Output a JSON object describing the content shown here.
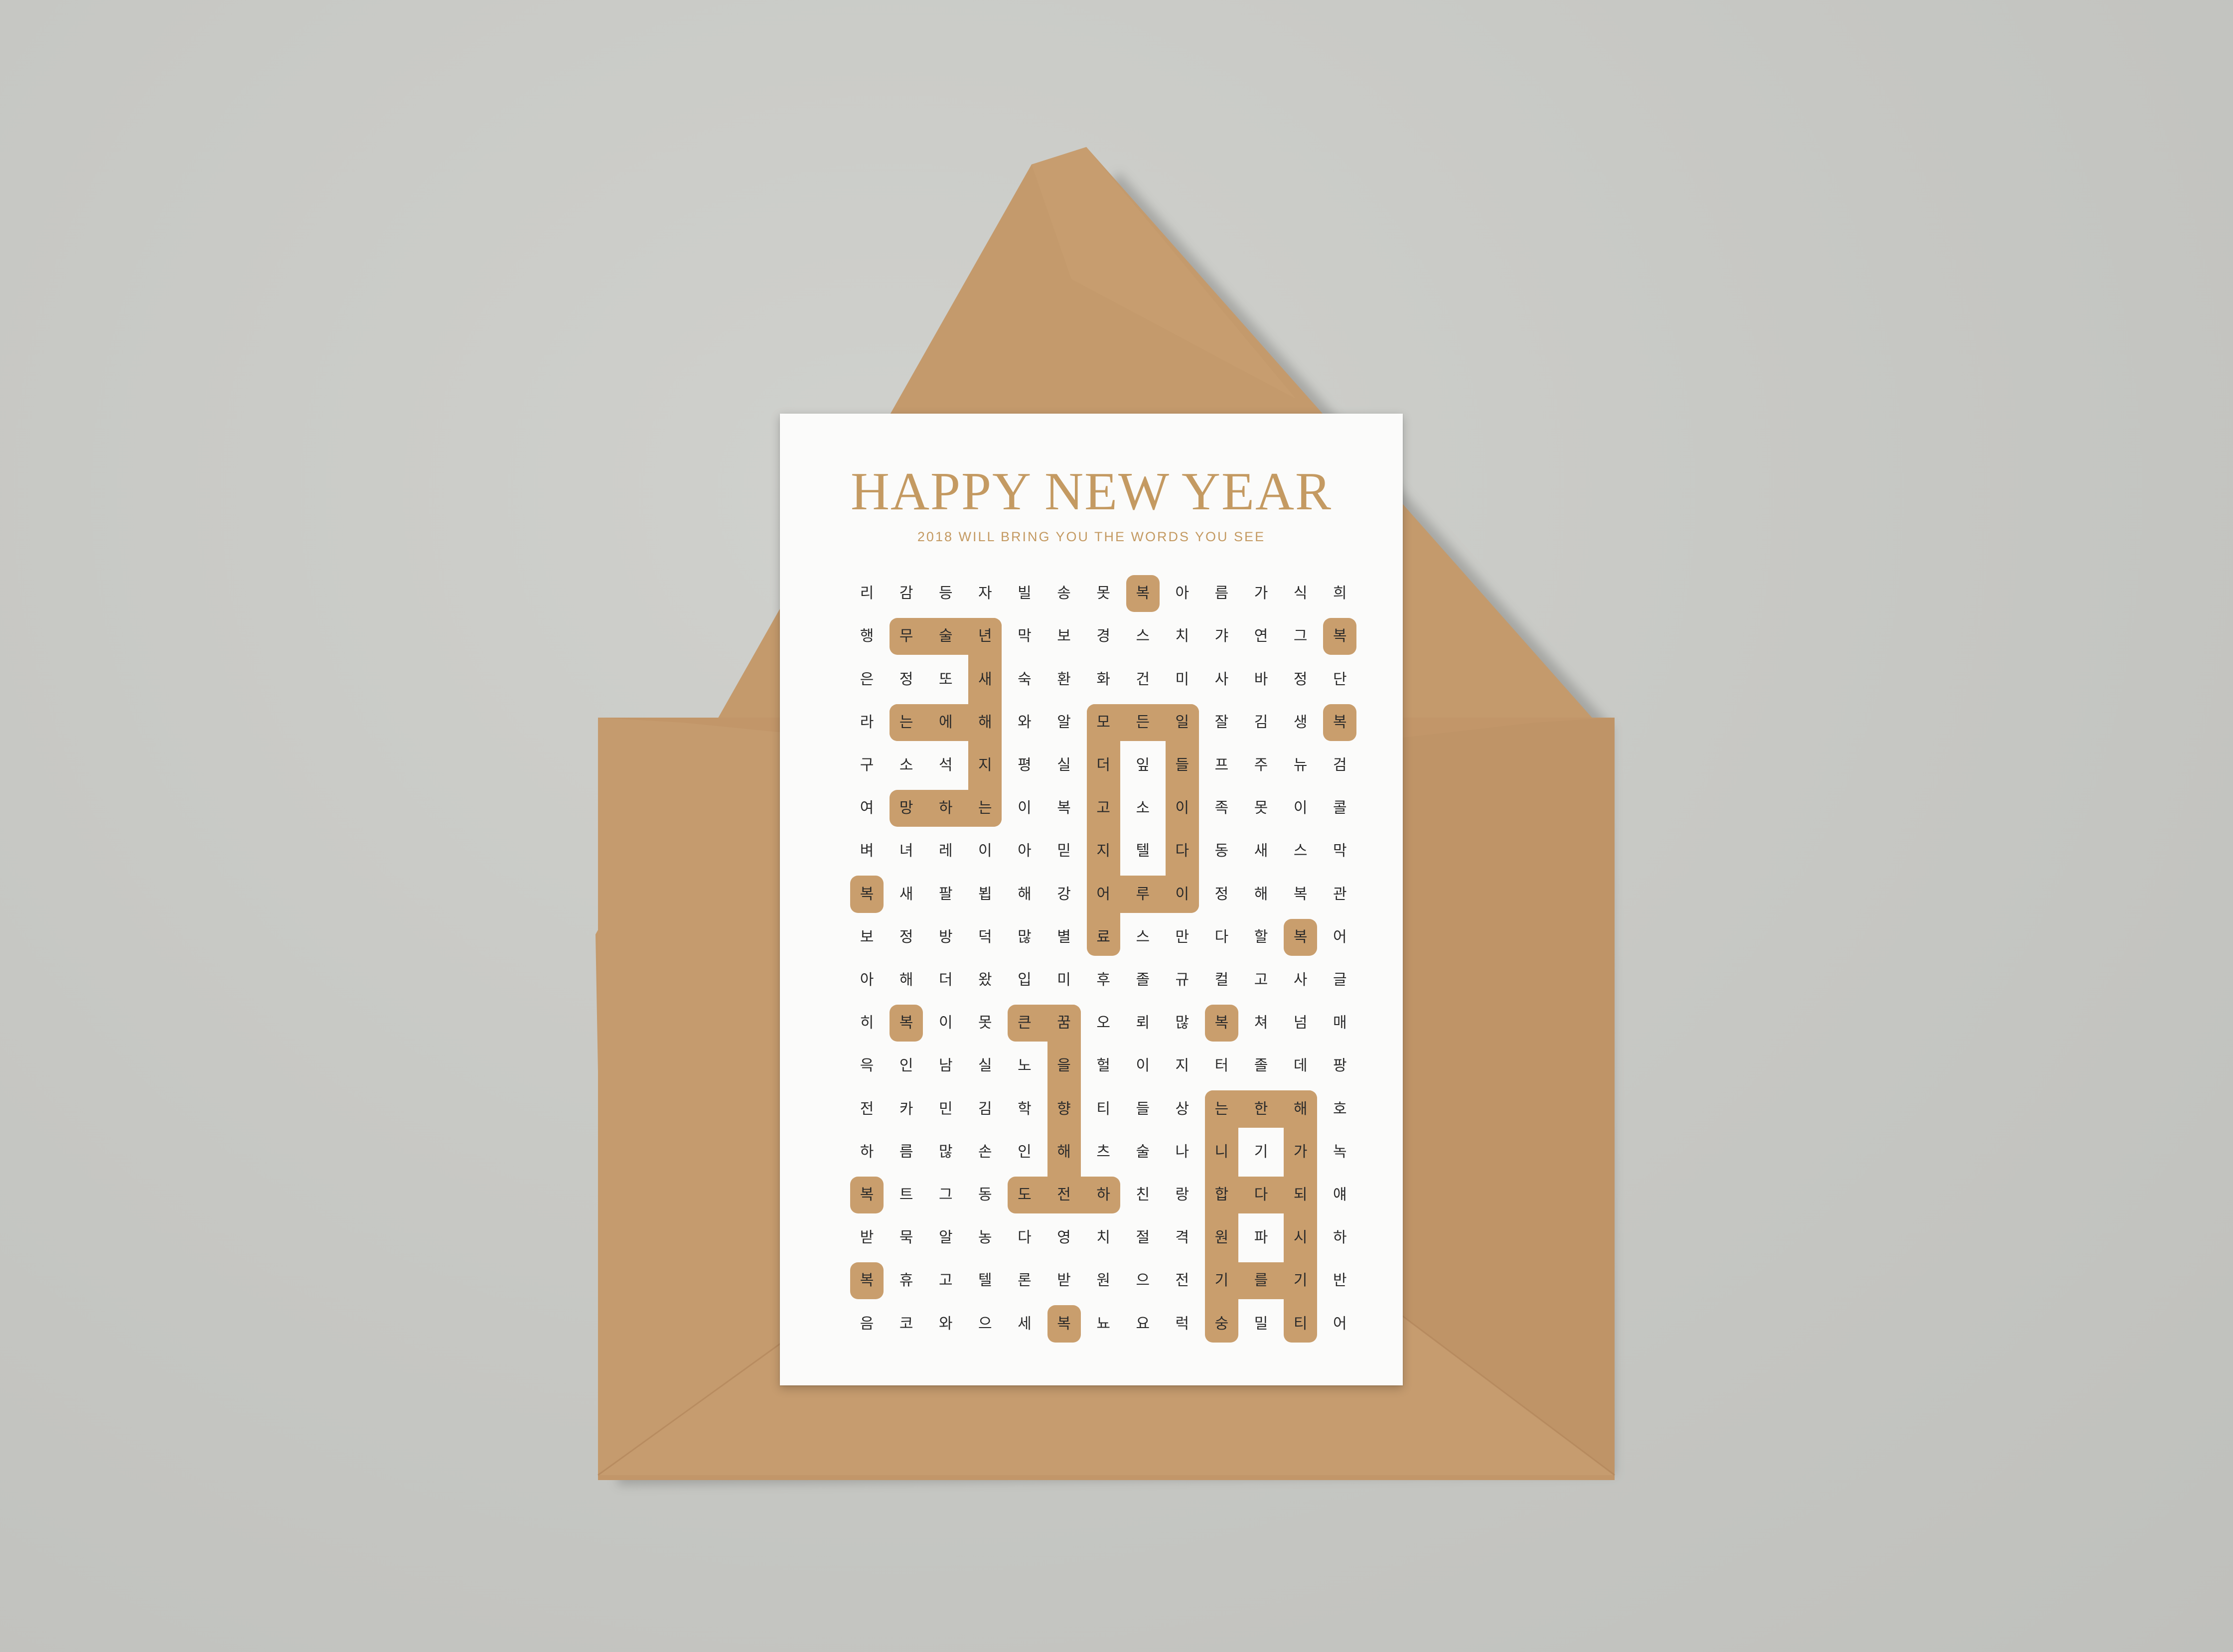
{
  "card": {
    "title": "HAPPY NEW YEAR",
    "subtitle": "2018 WILL BRING YOU THE WORDS YOU SEE",
    "accent_color": "#c99e6d",
    "title_color": "#c49a62"
  },
  "envelope": {
    "color": "#c49a6c"
  },
  "grid": [
    [
      "리",
      "감",
      "등",
      "자",
      "빌",
      "송",
      "못",
      "복",
      "아",
      "름",
      "가",
      "식",
      "희"
    ],
    [
      "행",
      "무",
      "술",
      "년",
      "막",
      "보",
      "경",
      "스",
      "치",
      "갸",
      "연",
      "그",
      "복"
    ],
    [
      "은",
      "정",
      "또",
      "새",
      "숙",
      "환",
      "화",
      "건",
      "미",
      "사",
      "바",
      "정",
      "단"
    ],
    [
      "라",
      "는",
      "에",
      "해",
      "와",
      "알",
      "모",
      "든",
      "일",
      "잘",
      "김",
      "생",
      "복"
    ],
    [
      "구",
      "소",
      "석",
      "지",
      "평",
      "실",
      "더",
      "잎",
      "들",
      "프",
      "주",
      "뉴",
      "검"
    ],
    [
      "여",
      "망",
      "하",
      "는",
      "이",
      "복",
      "고",
      "소",
      "이",
      "족",
      "못",
      "이",
      "콜"
    ],
    [
      "벼",
      "녀",
      "레",
      "이",
      "아",
      "믿",
      "지",
      "텔",
      "다",
      "동",
      "새",
      "스",
      "막"
    ],
    [
      "복",
      "새",
      "팔",
      "뵙",
      "해",
      "강",
      "어",
      "루",
      "이",
      "정",
      "해",
      "복",
      "관"
    ],
    [
      "보",
      "정",
      "방",
      "덕",
      "많",
      "별",
      "료",
      "스",
      "만",
      "다",
      "할",
      "복",
      "어"
    ],
    [
      "아",
      "해",
      "더",
      "왔",
      "입",
      "미",
      "후",
      "졸",
      "규",
      "컬",
      "고",
      "사",
      "글"
    ],
    [
      "히",
      "복",
      "이",
      "못",
      "큰",
      "꿈",
      "오",
      "뢰",
      "많",
      "복",
      "쳐",
      "넘",
      "매"
    ],
    [
      "윽",
      "인",
      "남",
      "실",
      "노",
      "을",
      "헐",
      "이",
      "지",
      "터",
      "졸",
      "데",
      "팡"
    ],
    [
      "전",
      "카",
      "민",
      "김",
      "학",
      "향",
      "티",
      "들",
      "상",
      "는",
      "한",
      "해",
      "호"
    ],
    [
      "하",
      "름",
      "많",
      "손",
      "인",
      "해",
      "츠",
      "술",
      "나",
      "니",
      "기",
      "가",
      "녹"
    ],
    [
      "복",
      "트",
      "그",
      "동",
      "도",
      "전",
      "하",
      "친",
      "랑",
      "합",
      "다",
      "되",
      "얘"
    ],
    [
      "받",
      "묵",
      "알",
      "농",
      "다",
      "영",
      "치",
      "절",
      "격",
      "원",
      "파",
      "시",
      "하"
    ],
    [
      "복",
      "휴",
      "고",
      "텔",
      "론",
      "받",
      "원",
      "으",
      "전",
      "기",
      "를",
      "기",
      "반"
    ],
    [
      "음",
      "코",
      "와",
      "으",
      "세",
      "복",
      "뇨",
      "요",
      "럭",
      "숭",
      "밀",
      "티",
      "어"
    ]
  ]
}
